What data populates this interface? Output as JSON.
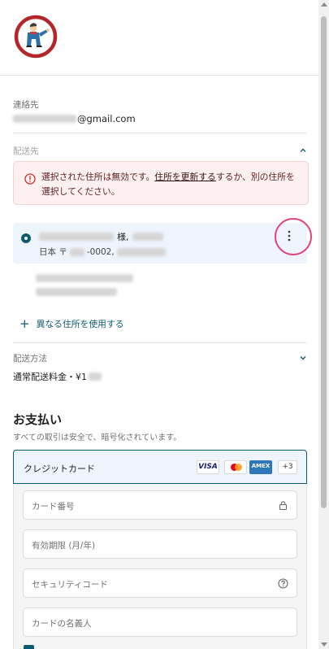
{
  "header": {
    "logo_alt": "store-logo"
  },
  "contact": {
    "label": "連絡先",
    "email_domain": "@gmail.com"
  },
  "shipping": {
    "label": "配送先",
    "error_prefix": "選択された住所は無効です。",
    "error_link": "住所を更新する",
    "error_suffix": "するか、別の住所を選択してください。",
    "selected_address": {
      "honorific": "様,",
      "country": "日本 〒",
      "postal_suffix": "-0002,"
    },
    "add_address": "異なる住所を使用する"
  },
  "shipping_method": {
    "label": "配送方法",
    "value_prefix": "通常配送料金・¥1"
  },
  "payment": {
    "title": "お支払い",
    "subtitle": "すべての取引は安全で、暗号化されています。",
    "method_label": "クレジットカード",
    "badges": {
      "visa": "VISA",
      "amex": "AMEX",
      "more": "+3"
    },
    "fields": {
      "card_number": "カード番号",
      "expiry": "有効期限 (月/年)",
      "cvc": "セキュリティコード",
      "name": "カードの名義人"
    }
  },
  "colors": {
    "accent": "#0e5b71",
    "error_bg": "#fdf0f0",
    "highlight_ring": "#e0457f",
    "selected_bg": "#edf4fc"
  }
}
